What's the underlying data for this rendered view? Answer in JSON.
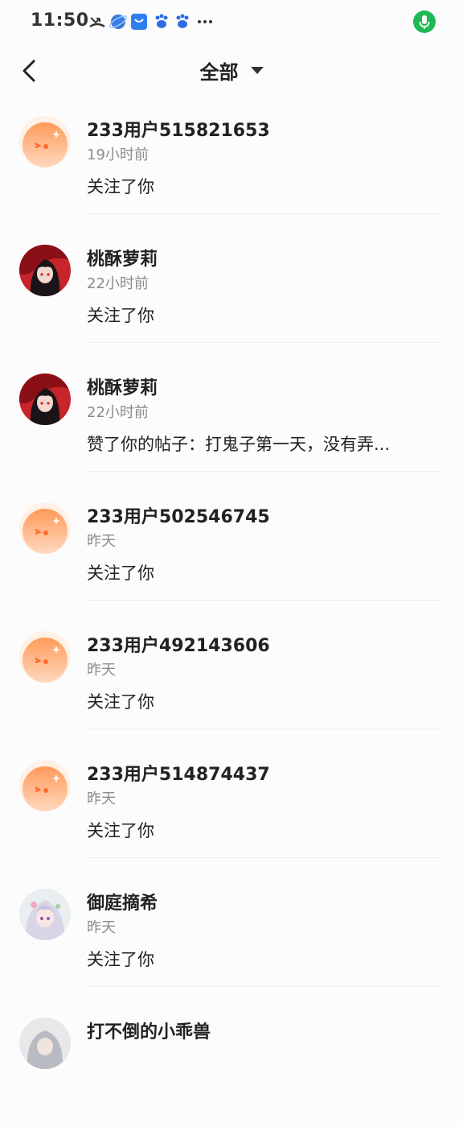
{
  "status_bar": {
    "time": "11:50",
    "icons": [
      "missed-call-icon",
      "browser-icon",
      "store-icon",
      "baidu-icon",
      "baidu-icon",
      "more-icon"
    ],
    "mic_color": "#1db954"
  },
  "header": {
    "title": "全部"
  },
  "notifications": [
    {
      "name": "233用户515821653",
      "time": "19小时前",
      "action": "关注了你",
      "avatar": "default-orange"
    },
    {
      "name": "桃酥萝莉",
      "time": "22小时前",
      "action": "关注了你",
      "avatar": "anime-red"
    },
    {
      "name": "桃酥萝莉",
      "time": "22小时前",
      "action": "赞了你的帖子：打鬼子第一天，没有弄...",
      "avatar": "anime-red"
    },
    {
      "name": "233用户502546745",
      "time": "昨天",
      "action": "关注了你",
      "avatar": "default-orange"
    },
    {
      "name": "233用户492143606",
      "time": "昨天",
      "action": "关注了你",
      "avatar": "default-orange"
    },
    {
      "name": "233用户514874437",
      "time": "昨天",
      "action": "关注了你",
      "avatar": "default-orange"
    },
    {
      "name": "御庭摘希",
      "time": "昨天",
      "action": "关注了你",
      "avatar": "anime-pastel"
    },
    {
      "name": "打不倒的小乖兽",
      "time": "",
      "action": "",
      "avatar": "anime-gray"
    }
  ]
}
